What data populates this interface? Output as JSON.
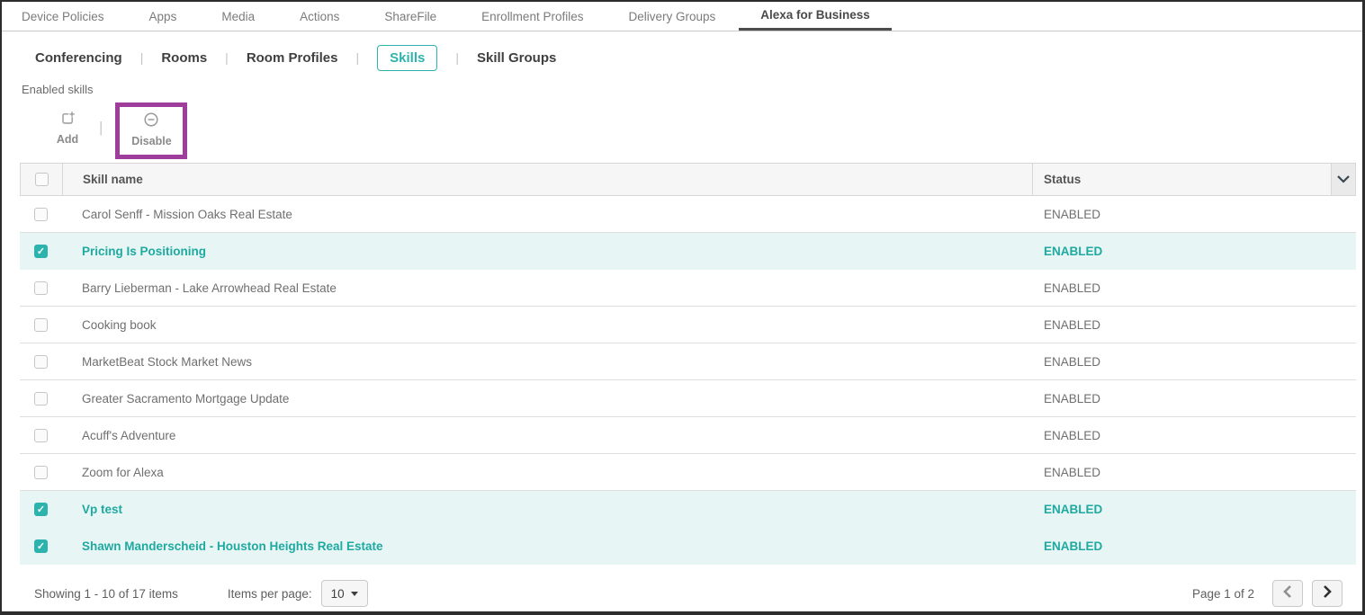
{
  "top_nav": {
    "tabs": [
      {
        "label": "Device Policies",
        "active": false
      },
      {
        "label": "Apps",
        "active": false
      },
      {
        "label": "Media",
        "active": false
      },
      {
        "label": "Actions",
        "active": false
      },
      {
        "label": "ShareFile",
        "active": false
      },
      {
        "label": "Enrollment Profiles",
        "active": false
      },
      {
        "label": "Delivery Groups",
        "active": false
      },
      {
        "label": "Alexa for Business",
        "active": true
      }
    ]
  },
  "sub_nav": {
    "separator": "|",
    "tabs": [
      {
        "label": "Conferencing",
        "active": false
      },
      {
        "label": "Rooms",
        "active": false
      },
      {
        "label": "Room Profiles",
        "active": false
      },
      {
        "label": "Skills",
        "active": true
      },
      {
        "label": "Skill Groups",
        "active": false
      }
    ]
  },
  "section_label": "Enabled skills",
  "toolbar": {
    "separator": "|",
    "add_label": "Add",
    "disable_label": "Disable",
    "disable_highlighted": true
  },
  "icons": {
    "checkmark_glyph": "✓"
  },
  "table": {
    "header": {
      "skill_name": "Skill name",
      "status": "Status"
    },
    "rows": [
      {
        "name": "Carol Senff - Mission Oaks Real Estate",
        "status": "ENABLED",
        "checked": false
      },
      {
        "name": "Pricing Is Positioning",
        "status": "ENABLED",
        "checked": true
      },
      {
        "name": "Barry Lieberman - Lake Arrowhead Real Estate",
        "status": "ENABLED",
        "checked": false
      },
      {
        "name": "Cooking book",
        "status": "ENABLED",
        "checked": false
      },
      {
        "name": "MarketBeat Stock Market News",
        "status": "ENABLED",
        "checked": false
      },
      {
        "name": "Greater Sacramento Mortgage Update",
        "status": "ENABLED",
        "checked": false
      },
      {
        "name": "Acuff's Adventure",
        "status": "ENABLED",
        "checked": false
      },
      {
        "name": "Zoom for Alexa",
        "status": "ENABLED",
        "checked": false
      },
      {
        "name": "Vp test",
        "status": "ENABLED",
        "checked": true
      },
      {
        "name": "Shawn Manderscheid - Houston Heights Real Estate",
        "status": "ENABLED",
        "checked": true
      }
    ]
  },
  "footer": {
    "showing_text": "Showing 1 - 10 of 17 items",
    "items_per_page_label": "Items per page:",
    "items_per_page_value": "10",
    "page_text": "Page 1 of 2"
  },
  "colors": {
    "accent_teal": "#2db3ad",
    "selected_row_bg": "#e7f6f5",
    "selected_row_text": "#1fa9a1",
    "highlight_purple": "#9e3d9b",
    "active_tab_underline": "#4d4d4d"
  }
}
